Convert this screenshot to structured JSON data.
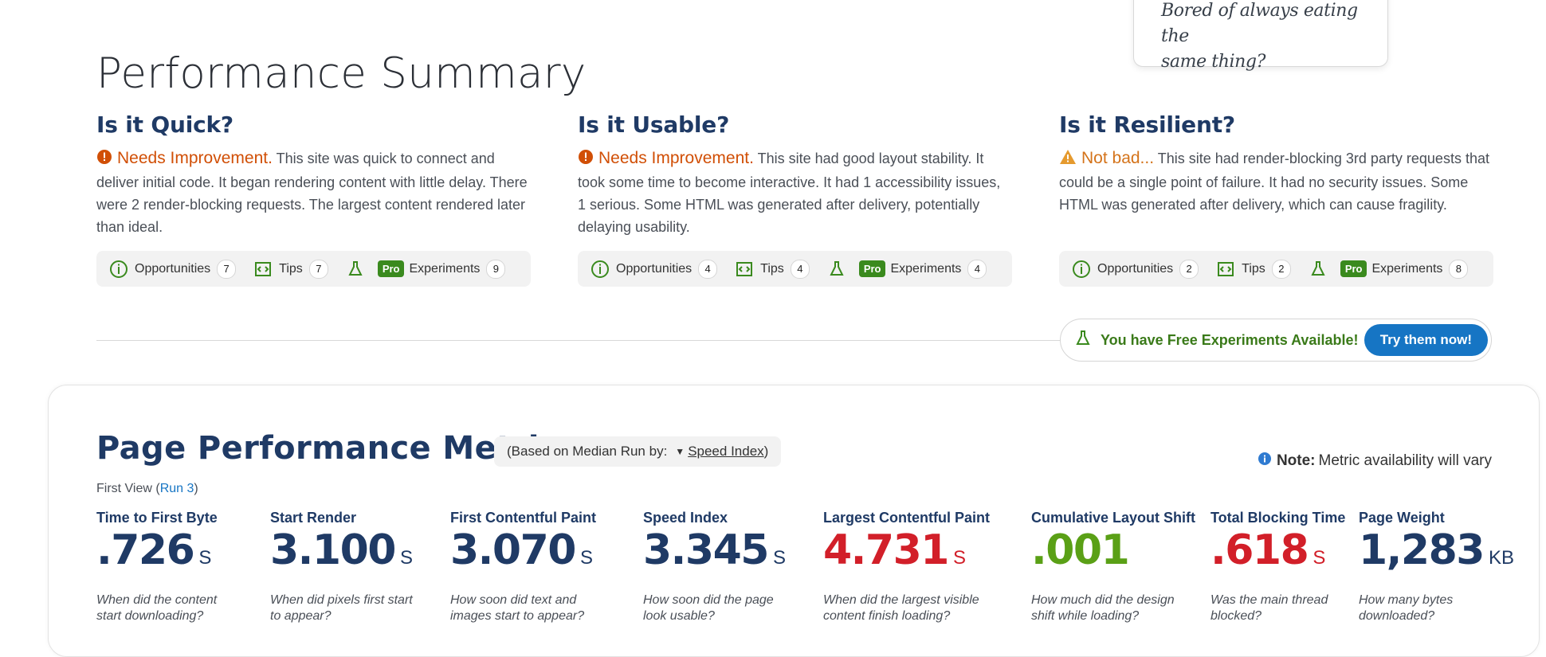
{
  "ad": {
    "text": "Bored of always eating the\nsame thing?"
  },
  "summary": {
    "title": "Performance Summary",
    "columns": [
      {
        "heading": "Is it Quick?",
        "status": "Needs Improvement.",
        "status_kind": "bad",
        "text": "This site was quick to connect and deliver initial code. It began rendering content with little delay. There were 2 render-blocking requests. The largest content rendered later than ideal.",
        "opportunities_label": "Opportunities",
        "opportunities": "7",
        "tips_label": "Tips",
        "tips": "7",
        "pro_label": "Pro",
        "experiments_label": "Experiments",
        "experiments": "9"
      },
      {
        "heading": "Is it Usable?",
        "status": "Needs Improvement.",
        "status_kind": "bad",
        "text": "This site had good layout stability. It took some time to become interactive. It had 1 accessibility issues, 1 serious. Some HTML was generated after delivery, potentially delaying usability.",
        "opportunities_label": "Opportunities",
        "opportunities": "4",
        "tips_label": "Tips",
        "tips": "4",
        "pro_label": "Pro",
        "experiments_label": "Experiments",
        "experiments": "4"
      },
      {
        "heading": "Is it Resilient?",
        "status": "Not bad...",
        "status_kind": "warn",
        "text": "This site had render-blocking 3rd party requests that could be a single point of failure. It had no security issues. Some HTML was generated after delivery, which can cause fragility.",
        "opportunities_label": "Opportunities",
        "opportunities": "2",
        "tips_label": "Tips",
        "tips": "2",
        "pro_label": "Pro",
        "experiments_label": "Experiments",
        "experiments": "8"
      }
    ]
  },
  "free_experiments": {
    "text": "You have Free Experiments Available!",
    "button": "Try them now!"
  },
  "metrics": {
    "title": "Page Performance Metrics",
    "median_prefix": "(Based on Median Run by:",
    "median_select": "Speed Index",
    "median_suffix": ")",
    "note_label": "Note:",
    "note_text": "Metric availability will vary",
    "first_view": "First View (",
    "run_link": "Run 3",
    "first_view_close": ")",
    "items": [
      {
        "label": "Time to First Byte",
        "value": ".726",
        "unit": "S",
        "desc": "When did the content\nstart downloading?",
        "color": "#1f3a65"
      },
      {
        "label": "Start Render",
        "value": "3.100",
        "unit": "S",
        "desc": "When did pixels first start\nto appear?",
        "color": "#1f3a65"
      },
      {
        "label": "First Contentful Paint",
        "value": "3.070",
        "unit": "S",
        "desc": "How soon did text and\nimages start to appear?",
        "color": "#1f3a65"
      },
      {
        "label": "Speed Index",
        "value": "3.345",
        "unit": "S",
        "desc": "How soon did the page\nlook usable?",
        "color": "#1f3a65"
      },
      {
        "label": "Largest Contentful Paint",
        "value": "4.731",
        "unit": "S",
        "desc": "When did the largest visible\ncontent finish loading?",
        "color": "#d21f29"
      },
      {
        "label": "Cumulative Layout Shift",
        "value": ".001",
        "unit": "",
        "desc": "How much did the design\nshift while loading?",
        "color": "#5aa016"
      },
      {
        "label": "Total Blocking Time",
        "value": ".618",
        "unit": "S",
        "desc": "Was the main thread\nblocked?",
        "color": "#d21f29"
      },
      {
        "label": "Page Weight",
        "value": "1,283",
        "unit": "KB",
        "desc": "How many bytes\ndownloaded?",
        "color": "#1f3a65"
      }
    ]
  }
}
